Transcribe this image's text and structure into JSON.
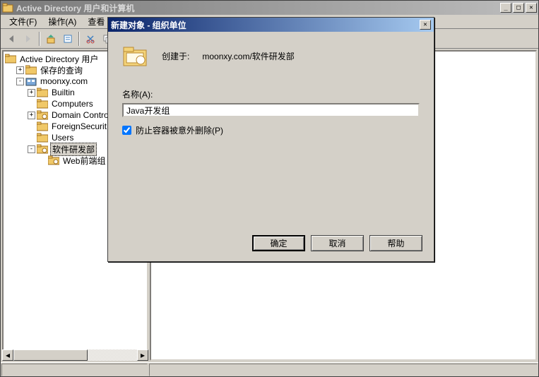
{
  "window": {
    "title": "Active Directory 用户和计算机"
  },
  "menu": {
    "file": "文件(F)",
    "action": "操作(A)",
    "view": "查看"
  },
  "tree": {
    "root": "Active Directory 用户",
    "saved_queries": "保存的查询",
    "domain": "moonxy.com",
    "builtin": "Builtin",
    "computers": "Computers",
    "domain_controllers": "Domain Control",
    "foreign": "ForeignSecurit",
    "users": "Users",
    "dept": "软件研发部",
    "web_group": "Web前端组"
  },
  "dialog": {
    "title": "新建对象 - 组织单位",
    "created_in_label": "创建于:",
    "created_in_path": "moonxy.com/软件研发部",
    "name_label": "名称(A):",
    "name_value": "Java开发组",
    "protect_label": "防止容器被意外删除(P)",
    "ok": "确定",
    "cancel": "取消",
    "help": "帮助"
  }
}
